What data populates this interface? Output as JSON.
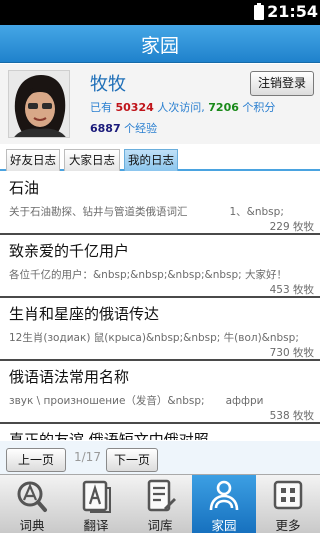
{
  "status": {
    "time": "21:54"
  },
  "header": {
    "title": "家园"
  },
  "profile": {
    "username": "牧牧",
    "logout_label": "注销登录",
    "visits_prefix": "已有 ",
    "visits": "50324",
    "visits_suffix": " 人次访问, ",
    "points": "7206",
    "points_suffix": " 个积分",
    "experience": "6887",
    "experience_suffix": " 个经验"
  },
  "tabs": [
    {
      "label": "好友日志"
    },
    {
      "label": "大家日志"
    },
    {
      "label": "我的日志"
    }
  ],
  "posts": [
    {
      "title": "石油",
      "summary": "关于石油勘探、钻井与管道类俄语词汇　　　　1、&nbsp;",
      "count": "229 牧牧"
    },
    {
      "title": "致亲爱的千亿用户",
      "summary": "各位千亿的用户：&nbsp;&nbsp;&nbsp;&nbsp; 大家好！",
      "count": "453 牧牧"
    },
    {
      "title": "生肖和星座的俄语传达",
      "summary": "12生肖(зодиак) 鼠(крыса)&nbsp;&nbsp; 牛(вол)&nbsp;",
      "count": "730 牧牧"
    },
    {
      "title": "俄语语法常用名称",
      "summary": "звук \\ произношение（发音）&nbsp;　　аффри",
      "count": "538 牧牧"
    },
    {
      "title": "真正的友谊 俄语短文中俄对照",
      "summary": "",
      "count": ""
    }
  ],
  "pager": {
    "prev_label": "上一页",
    "page_info": "1/17",
    "next_label": "下一页"
  },
  "nav": [
    {
      "label": "词典",
      "icon": "dictionary-icon"
    },
    {
      "label": "翻译",
      "icon": "translate-icon"
    },
    {
      "label": "词库",
      "icon": "wordbank-icon"
    },
    {
      "label": "家园",
      "icon": "home-community-icon"
    },
    {
      "label": "更多",
      "icon": "more-icon"
    }
  ],
  "colors": {
    "accent": "#1f82cc",
    "active_tab": "#8cc6ee",
    "visits": "#c0141a",
    "points": "#1a8a1a"
  }
}
